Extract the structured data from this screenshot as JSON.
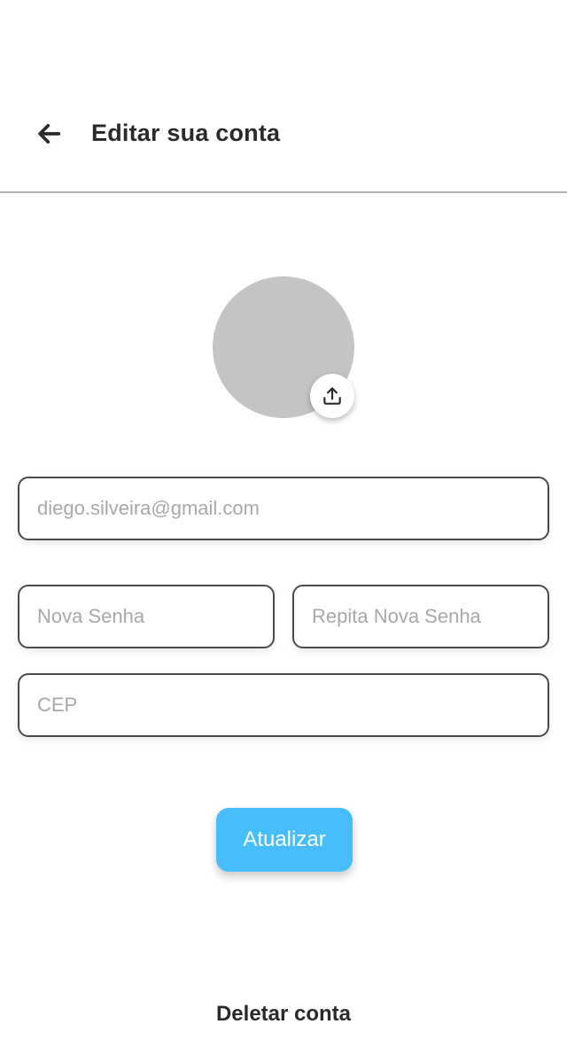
{
  "header": {
    "title": "Editar sua conta",
    "back_icon": "arrow-left-icon"
  },
  "profile": {
    "avatar_color": "#c4c4c4",
    "upload_icon": "upload-icon"
  },
  "form": {
    "email": {
      "placeholder": "diego.silveira@gmail.com",
      "value": ""
    },
    "new_password": {
      "placeholder": "Nova Senha",
      "value": ""
    },
    "repeat_password": {
      "placeholder": "Repita Nova Senha",
      "value": ""
    },
    "cep": {
      "placeholder": "CEP",
      "value": ""
    }
  },
  "actions": {
    "update_label": "Atualizar",
    "delete_label": "Deletar conta"
  },
  "colors": {
    "accent": "#47bdf9",
    "border": "#4a4a4a",
    "divider": "#b3b3b3"
  }
}
